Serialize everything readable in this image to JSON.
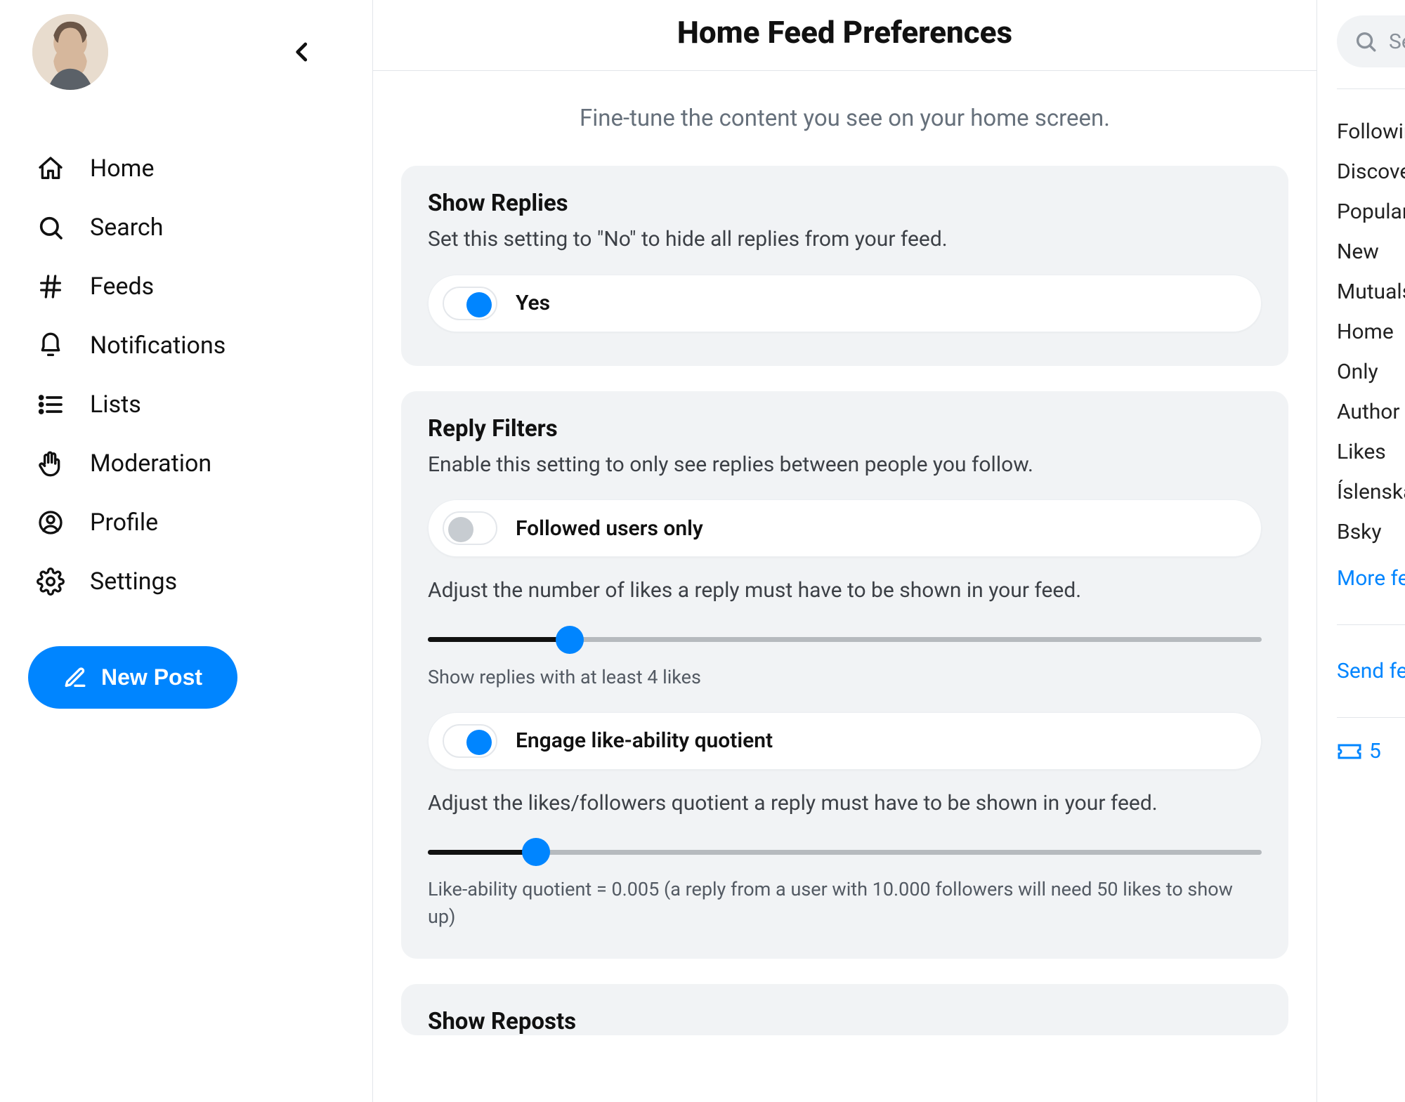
{
  "sidebar": {
    "nav": [
      {
        "key": "home",
        "label": "Home"
      },
      {
        "key": "search",
        "label": "Search"
      },
      {
        "key": "feeds",
        "label": "Feeds"
      },
      {
        "key": "notifications",
        "label": "Notifications"
      },
      {
        "key": "lists",
        "label": "Lists"
      },
      {
        "key": "moderation",
        "label": "Moderation"
      },
      {
        "key": "profile",
        "label": "Profile"
      },
      {
        "key": "settings",
        "label": "Settings"
      }
    ],
    "new_post_label": "New Post"
  },
  "page": {
    "title": "Home Feed Preferences",
    "subtitle": "Fine-tune the content you see on your home screen."
  },
  "cards": {
    "show_replies": {
      "title": "Show Replies",
      "desc": "Set this setting to \"No\" to hide all replies from your feed.",
      "toggle_label": "Yes",
      "toggle_on": true
    },
    "reply_filters": {
      "title": "Reply Filters",
      "desc": "Enable this setting to only see replies between people you follow.",
      "followed_only": {
        "label": "Followed users only",
        "on": false
      },
      "likes_slider": {
        "desc": "Adjust the number of likes a reply must have to be shown in your feed.",
        "caption": "Show replies with at least 4 likes",
        "value": 4,
        "fill_percent": 17
      },
      "engage_toggle": {
        "label": "Engage like-ability quotient",
        "on": true
      },
      "quotient_slider": {
        "desc": "Adjust the likes/followers quotient a reply must have to be shown in your feed.",
        "caption": "Like-ability quotient = 0.005 (a reply from a user with 10.000 followers will need 50 likes to show up)",
        "value": 0.005,
        "fill_percent": 13
      }
    },
    "show_reposts": {
      "title": "Show Reposts"
    }
  },
  "right": {
    "search_placeholder": "Search",
    "items": [
      "Following",
      "Discover",
      "Popular",
      "New",
      "Mutuals",
      "Home",
      "Only",
      "Author",
      "Likes",
      "Íslenska",
      "Bsky"
    ],
    "more_label": "More feeds",
    "send_label": "Send feedback",
    "ticket_count": "5"
  },
  "colors": {
    "accent": "#0085ff",
    "panel_bg": "#f1f3f5",
    "text_muted": "#66707b"
  }
}
